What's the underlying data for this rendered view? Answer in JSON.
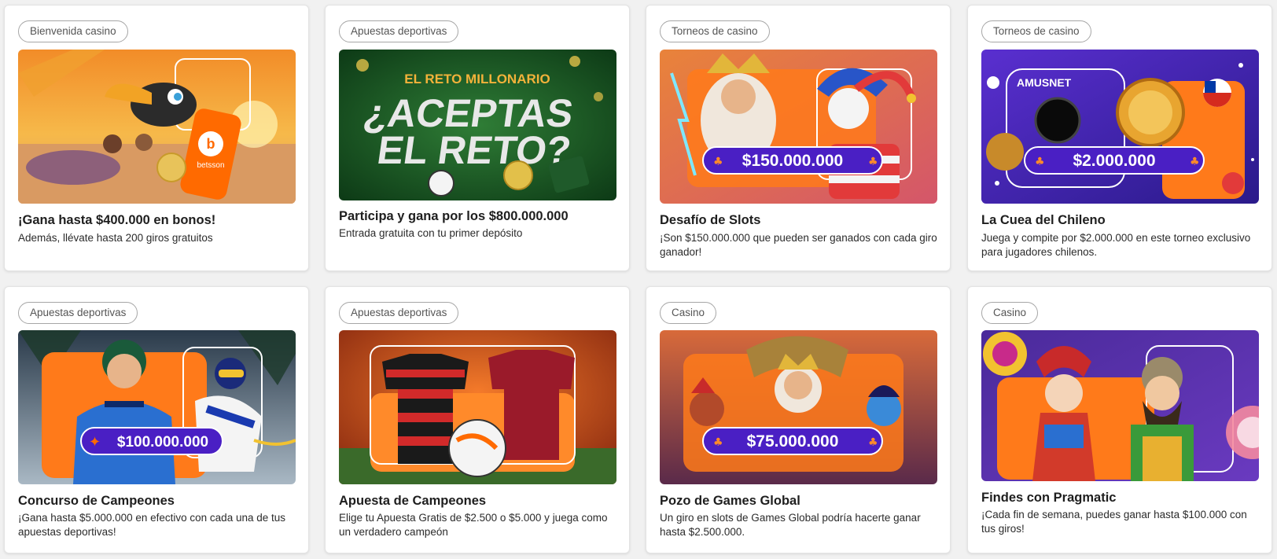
{
  "cards": [
    {
      "tag": "Bienvenida casino",
      "title": "¡Gana hasta $400.000 en bonos!",
      "description": "Además, llévate hasta 200 giros gratuitos",
      "banner_text": "betsson"
    },
    {
      "tag": "Apuestas deportivas",
      "title": "Participa y gana por los $800.000.000",
      "description": "Entrada gratuita con tu primer depósito",
      "banner_line1": "EL RETO MILLONARIO",
      "banner_line2": "¿ACEPTAS",
      "banner_line3": "EL RETO?"
    },
    {
      "tag": "Torneos de casino",
      "title": "Desafío de Slots",
      "description": "¡Son $150.000.000 que pueden ser ganados con cada giro ganador!",
      "banner_amount": "$150.000.000"
    },
    {
      "tag": "Torneos de casino",
      "title": "La Cuea del Chileno",
      "description": "Juega y compite por $2.000.000 en este torneo exclusivo para jugadores chilenos.",
      "banner_brand": "AMUSNET",
      "banner_amount": "$2.000.000"
    },
    {
      "tag": "Apuestas deportivas",
      "title": "Concurso de Campeones",
      "description": "¡Gana hasta $5.000.000 en efectivo con cada una de tus apuestas deportivas!",
      "banner_amount": "$100.000.000"
    },
    {
      "tag": "Apuestas deportivas",
      "title": "Apuesta de Campeones",
      "description": "Elige tu Apuesta Gratis de $2.500 o $5.000 y juega como un verdadero campeón"
    },
    {
      "tag": "Casino",
      "title": "Pozo de Games Global",
      "description": "Un giro en slots de Games Global podría hacerte ganar hasta $2.500.000.",
      "banner_amount": "$75.000.000"
    },
    {
      "tag": "Casino",
      "title": "Findes con Pragmatic",
      "description": "¡Cada fin de semana, puedes ganar hasta $100.000 con tus giros!"
    }
  ],
  "colors": {
    "page_background": "#f1f1f1",
    "card_background": "#ffffff",
    "tag_border": "#a6a6a6",
    "brand_orange": "#ff6a00",
    "amount_pill": "#4a1fc4"
  },
  "icons": {
    "cherry": "cherry-icon",
    "star": "star-icon"
  }
}
